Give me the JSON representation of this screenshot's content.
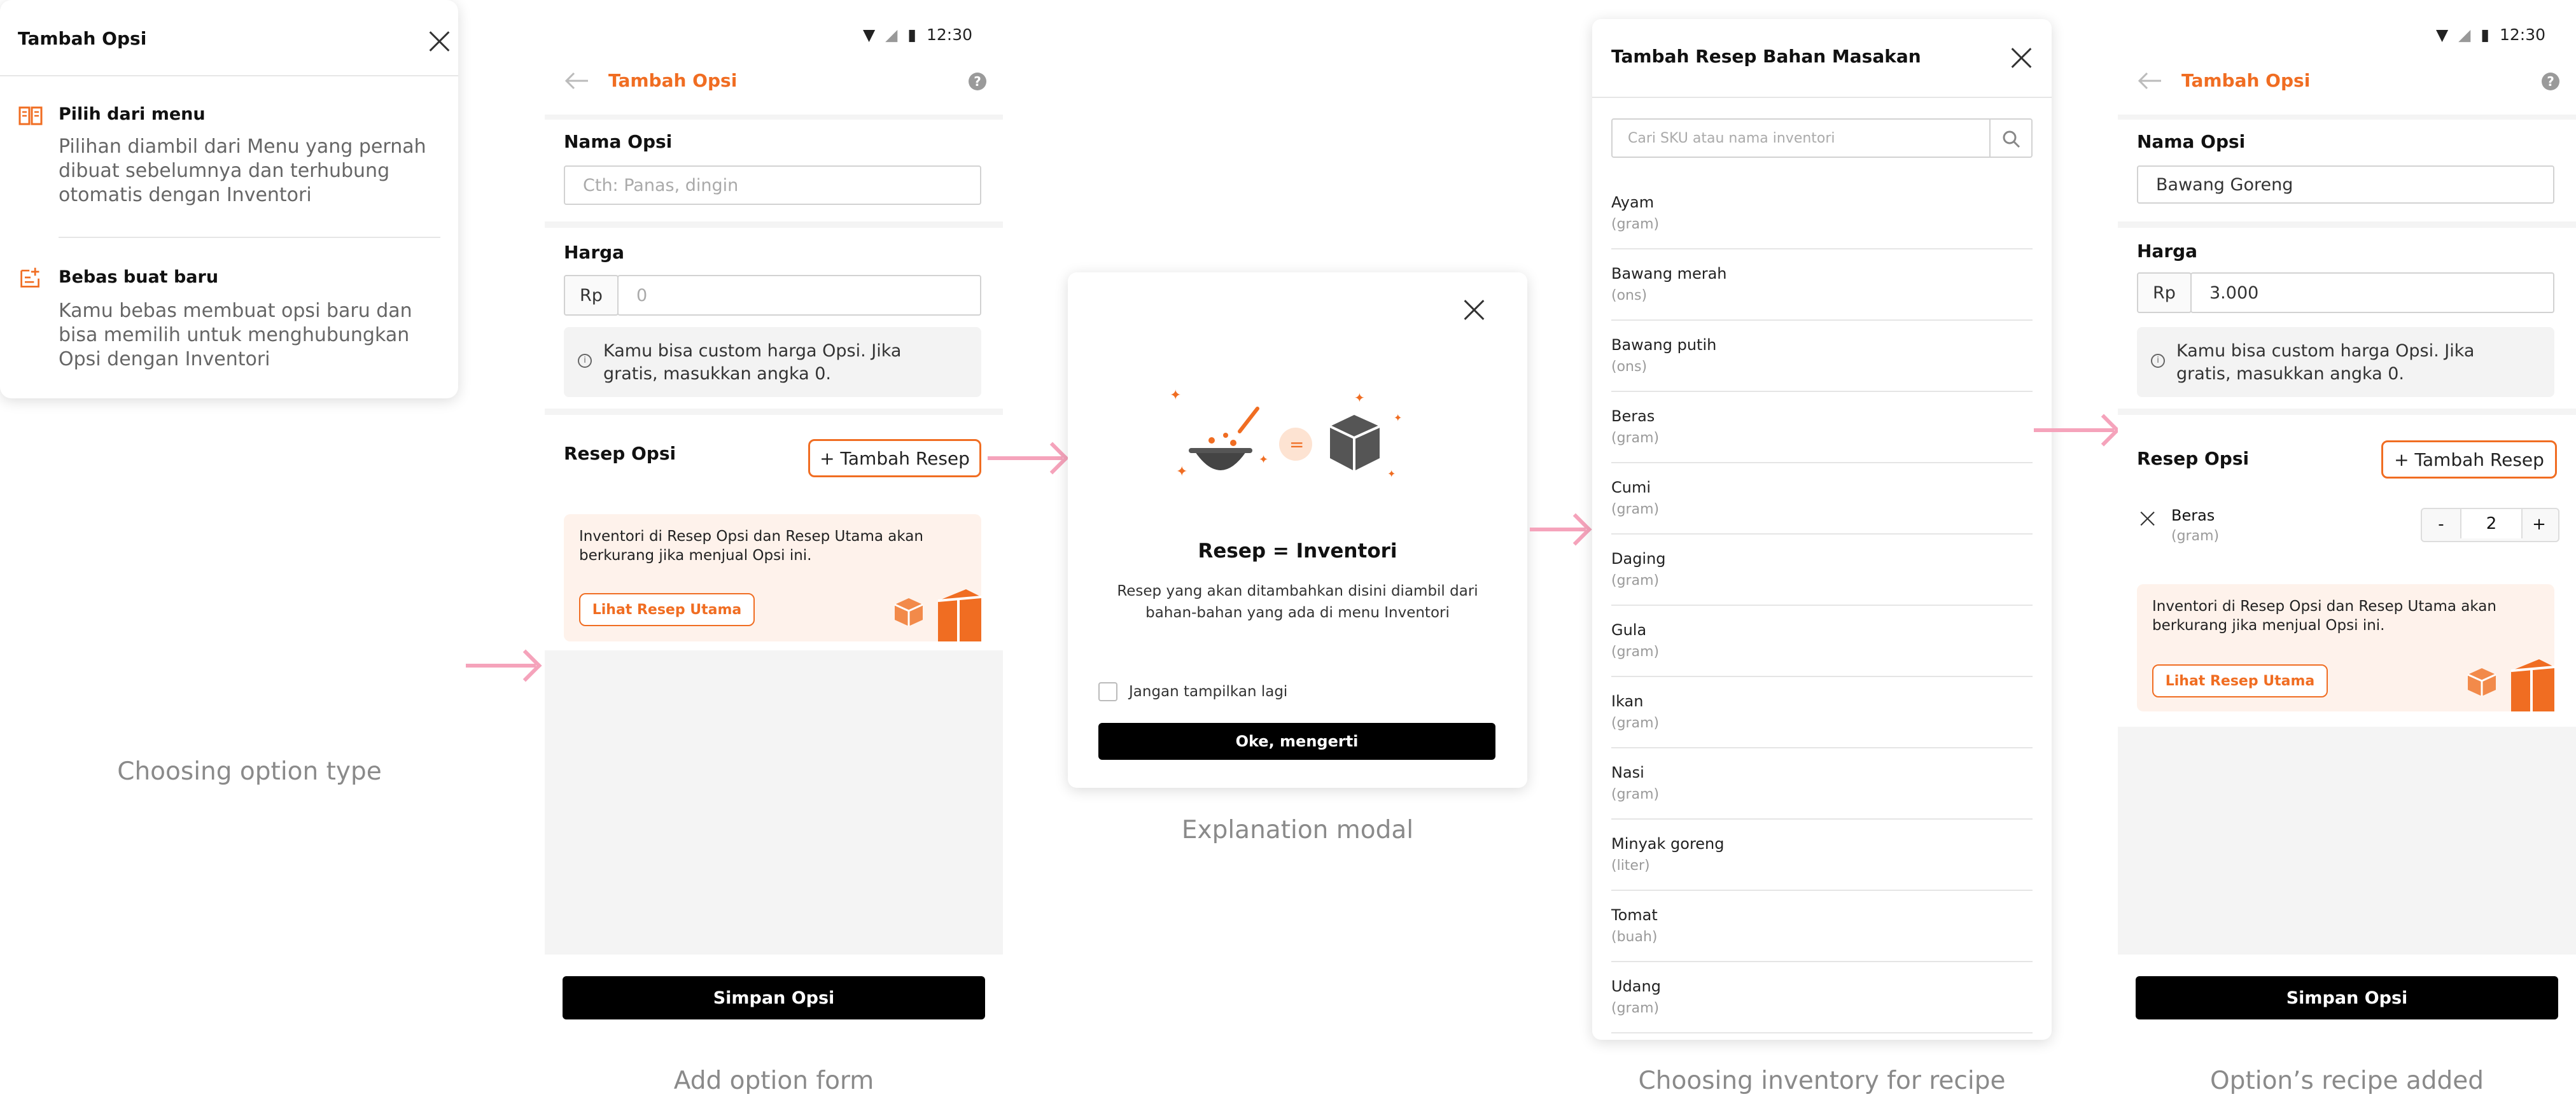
{
  "captions": {
    "c1": "Choosing option type",
    "c2": "Add option form",
    "c3": "Explanation modal",
    "c4": "Choosing inventory for recipe",
    "c5": "Option’s recipe added"
  },
  "status": {
    "time": "12:30"
  },
  "option_type_card": {
    "title": "Tambah Opsi",
    "options": [
      {
        "title": "Pilih dari menu",
        "desc": "Pilihan diambil dari Menu yang pernah dibuat sebelumnya dan terhubung otomatis dengan Inventori"
      },
      {
        "title": "Bebas buat baru",
        "desc": "Kamu bebas membuat opsi baru dan bisa memilih untuk menghubungkan Opsi dengan Inventori"
      }
    ]
  },
  "add_form": {
    "header_title": "Tambah Opsi",
    "help": "?",
    "name_label": "Nama Opsi",
    "name_placeholder": "Cth: Panas, dingin",
    "price_label": "Harga",
    "currency": "Rp",
    "price_placeholder": "0",
    "info": "Kamu bisa custom harga Opsi. Jika gratis, masukkan angka 0.",
    "recipe_label": "Resep Opsi",
    "add_recipe": "+ Tambah Resep",
    "promo_text": "Inventori di Resep Opsi dan Resep Utama akan berkurang jika menjual Opsi ini.",
    "promo_button": "Lihat Resep Utama",
    "save": "Simpan Opsi"
  },
  "modal": {
    "heading": "Resep = Inventori",
    "desc": "Resep yang akan ditambahkan disini diambil dari bahan-bahan yang ada di menu Inventori",
    "equals": "=",
    "checkbox_label": "Jangan tampilkan lagi",
    "ok": "Oke, mengerti"
  },
  "inventory": {
    "title": "Tambah Resep Bahan Masakan",
    "search_placeholder": "Cari SKU atau nama inventori",
    "items": [
      {
        "name": "Ayam",
        "unit": "(gram)"
      },
      {
        "name": "Bawang merah",
        "unit": "(ons)"
      },
      {
        "name": "Bawang putih",
        "unit": "(ons)"
      },
      {
        "name": "Beras",
        "unit": "(gram)"
      },
      {
        "name": "Cumi",
        "unit": "(gram)"
      },
      {
        "name": "Daging",
        "unit": "(gram)"
      },
      {
        "name": "Gula",
        "unit": "(gram)"
      },
      {
        "name": "Ikan",
        "unit": "(gram)"
      },
      {
        "name": "Nasi",
        "unit": "(gram)"
      },
      {
        "name": "Minyak goreng",
        "unit": "(liter)"
      },
      {
        "name": "Tomat",
        "unit": "(buah)"
      },
      {
        "name": "Udang",
        "unit": "(gram)"
      }
    ]
  },
  "filled_form": {
    "name_value": "Bawang Goreng",
    "price_value": "3.000",
    "recipe_item": {
      "name": "Beras",
      "unit": "(gram)",
      "qty": "2",
      "minus": "-",
      "plus": "+"
    }
  }
}
